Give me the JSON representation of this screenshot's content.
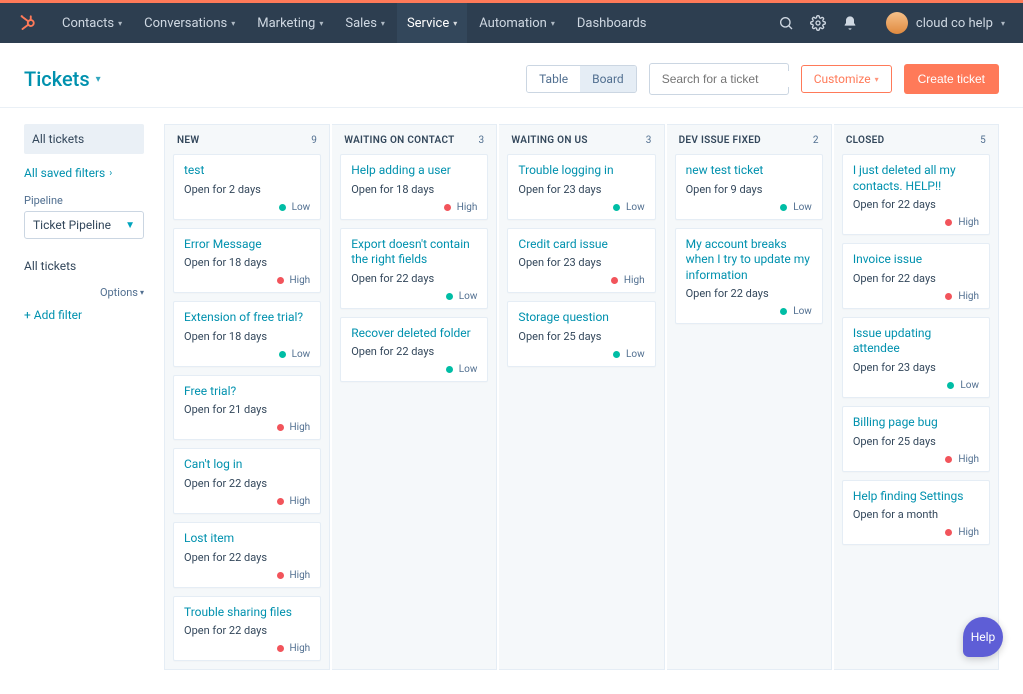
{
  "nav": {
    "items": [
      {
        "label": "Contacts",
        "caret": true,
        "active": false
      },
      {
        "label": "Conversations",
        "caret": true,
        "active": false
      },
      {
        "label": "Marketing",
        "caret": true,
        "active": false
      },
      {
        "label": "Sales",
        "caret": true,
        "active": false
      },
      {
        "label": "Service",
        "caret": true,
        "active": true
      },
      {
        "label": "Automation",
        "caret": true,
        "active": false
      },
      {
        "label": "Dashboards",
        "caret": false,
        "active": false
      }
    ],
    "user_label": "cloud co help"
  },
  "page": {
    "title": "Tickets",
    "view_toggle": {
      "table": "Table",
      "board": "Board"
    },
    "search_placeholder": "Search for a ticket",
    "customize_label": "Customize",
    "create_label": "Create ticket"
  },
  "sidebar": {
    "all_tickets_tab": "All tickets",
    "saved_filters_link": "All saved filters",
    "pipeline_label": "Pipeline",
    "pipeline_value": "Ticket Pipeline",
    "filter_heading": "All tickets",
    "options_label": "Options",
    "add_filter_label": "+ Add filter"
  },
  "board": {
    "columns": [
      {
        "title": "NEW",
        "count": 9,
        "cards": [
          {
            "title": "test",
            "sub": "Open for 2 days",
            "priority": "Low"
          },
          {
            "title": "Error Message",
            "sub": "Open for 18 days",
            "priority": "High"
          },
          {
            "title": "Extension of free trial?",
            "sub": "Open for 18 days",
            "priority": "Low"
          },
          {
            "title": "Free trial?",
            "sub": "Open for 21 days",
            "priority": "High"
          },
          {
            "title": "Can't log in",
            "sub": "Open for 22 days",
            "priority": "High"
          },
          {
            "title": "Lost item",
            "sub": "Open for 22 days",
            "priority": "High"
          },
          {
            "title": "Trouble sharing files",
            "sub": "Open for 22 days",
            "priority": "High"
          }
        ]
      },
      {
        "title": "WAITING ON CONTACT",
        "count": 3,
        "cards": [
          {
            "title": "Help adding a user",
            "sub": "Open for 18 days",
            "priority": "High"
          },
          {
            "title": "Export doesn't contain the right fields",
            "sub": "Open for 22 days",
            "priority": "Low"
          },
          {
            "title": "Recover deleted folder",
            "sub": "Open for 22 days",
            "priority": "Low"
          }
        ]
      },
      {
        "title": "WAITING ON US",
        "count": 3,
        "cards": [
          {
            "title": "Trouble logging in",
            "sub": "Open for 23 days",
            "priority": "Low"
          },
          {
            "title": "Credit card issue",
            "sub": "Open for 23 days",
            "priority": "High"
          },
          {
            "title": "Storage question",
            "sub": "Open for 25 days",
            "priority": "Low"
          }
        ]
      },
      {
        "title": "DEV ISSUE FIXED",
        "count": 2,
        "cards": [
          {
            "title": "new test ticket",
            "sub": "Open for 9 days",
            "priority": "Low"
          },
          {
            "title": "My account breaks when I try to update my information",
            "sub": "Open for 22 days",
            "priority": "Low"
          }
        ]
      },
      {
        "title": "CLOSED",
        "count": 5,
        "cards": [
          {
            "title": "I just deleted all my contacts. HELP!!",
            "sub": "Open for 22 days",
            "priority": "High"
          },
          {
            "title": "Invoice issue",
            "sub": "Open for 22 days",
            "priority": "High"
          },
          {
            "title": "Issue updating attendee",
            "sub": "Open for 23 days",
            "priority": "Low"
          },
          {
            "title": "Billing page bug",
            "sub": "Open for 25 days",
            "priority": "High"
          },
          {
            "title": "Help finding Settings",
            "sub": "Open for a month",
            "priority": "High"
          }
        ]
      }
    ]
  },
  "help_label": "Help"
}
